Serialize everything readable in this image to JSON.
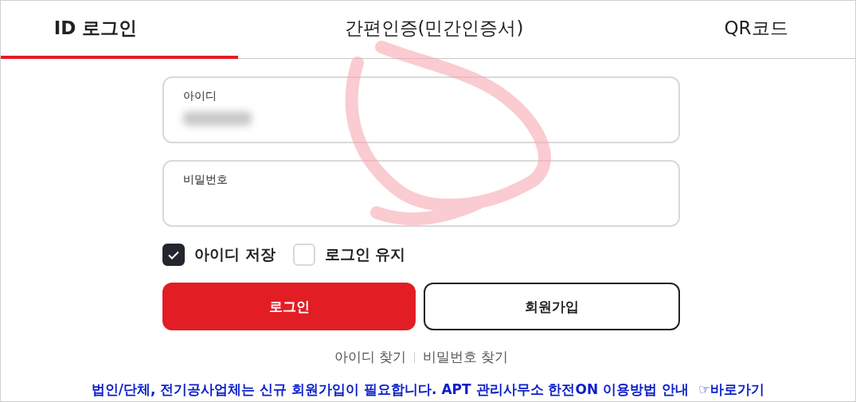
{
  "tabs": [
    {
      "label": "ID 로그인",
      "selected": true
    },
    {
      "label": "간편인증(민간인증서)",
      "selected": false
    },
    {
      "label": "QR코드",
      "selected": false
    }
  ],
  "fields": [
    {
      "label": "아이디",
      "blurred": true
    },
    {
      "label": "비밀번호",
      "blurred": false
    }
  ],
  "checkboxes": [
    {
      "label": "아이디 저장",
      "checked": true
    },
    {
      "label": "로그인 유지",
      "checked": false
    }
  ],
  "buttons": [
    {
      "label": "로그인",
      "kind": "primary"
    },
    {
      "label": "회원가입",
      "kind": "secondary"
    }
  ],
  "links": [
    "아이디 찾기",
    "비밀번호 찾기"
  ],
  "notice": {
    "text": "법인/단체, 전기공사업체는 신규 회원가입이 필요합니다. APT 관리사무소 한전ON 이용방법 안내",
    "link": "☞바로가기"
  }
}
